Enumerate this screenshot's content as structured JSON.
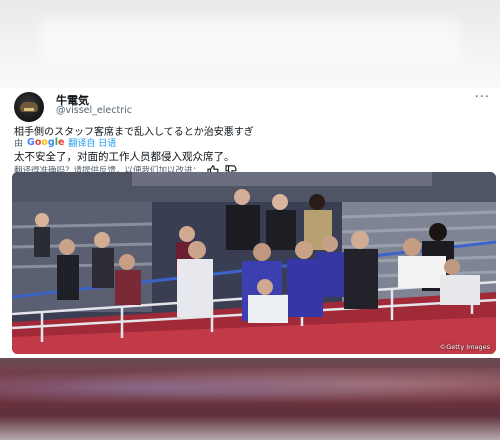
{
  "post": {
    "display_name": "牛電気",
    "handle": "@vissel_electric",
    "more": "···",
    "original_text": "相手側のスタッフ客席まで乱入してるとか治安悪すぎ",
    "translated_by_prefix": "由",
    "translated_by_service": "Google",
    "translated_from": "翻译自 日语",
    "translated_text": "太不安全了，对面的工作人员都侵入观众席了。",
    "feedback_prompt": "翻译得准确吗？请提供反馈，以便我们加以改进："
  },
  "photo": {
    "credit": "©Getty Images"
  },
  "colors": {
    "google_blue": "#4285F4",
    "google_red": "#EA4335",
    "google_yellow": "#FBBC05",
    "google_green": "#34A853",
    "translate_link": "#1d9bf0"
  }
}
